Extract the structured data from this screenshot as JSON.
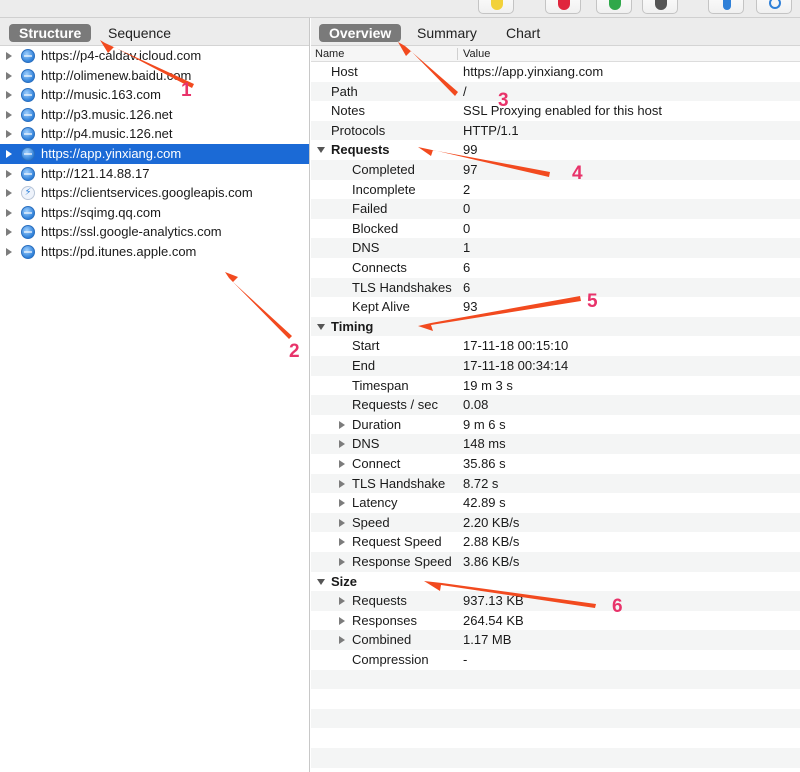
{
  "colors": {
    "selection": "#1b6ad6",
    "active_tab": "#7a7a7a",
    "arrow": "#f24a1f",
    "callout": "#e8336a"
  },
  "left_tabs": [
    "Structure",
    "Sequence"
  ],
  "right_tabs": [
    "Overview",
    "Summary",
    "Chart"
  ],
  "hosts": [
    {
      "url": "https://p4-caldav.icloud.com",
      "icon": "globe-icon"
    },
    {
      "url": "http://olimenew.baidu.com",
      "icon": "globe-icon"
    },
    {
      "url": "http://music.163.com",
      "icon": "globe-icon"
    },
    {
      "url": "http://p3.music.126.net",
      "icon": "globe-icon"
    },
    {
      "url": "http://p4.music.126.net",
      "icon": "globe-icon"
    },
    {
      "url": "https://app.yinxiang.com",
      "icon": "globe-icon",
      "selected": true
    },
    {
      "url": "http://121.14.88.17",
      "icon": "globe-icon"
    },
    {
      "url": "https://clientservices.googleapis.com",
      "icon": "lightning-icon"
    },
    {
      "url": "https://sqimg.qq.com",
      "icon": "globe-icon"
    },
    {
      "url": "https://ssl.google-analytics.com",
      "icon": "globe-icon"
    },
    {
      "url": "https://pd.itunes.apple.com",
      "icon": "globe-icon"
    }
  ],
  "columns": {
    "name": "Name",
    "value": "Value"
  },
  "rows": [
    {
      "name": "Host",
      "value": "https://app.yinxiang.com",
      "indent": 0
    },
    {
      "name": "Path",
      "value": "/",
      "indent": 0
    },
    {
      "name": "Notes",
      "value": "SSL Proxying enabled for this host",
      "indent": 0
    },
    {
      "name": "Protocols",
      "value": "HTTP/1.1",
      "indent": 0
    },
    {
      "name": "Requests",
      "value": "99",
      "indent": 0,
      "section": true
    },
    {
      "name": "Completed",
      "value": "97",
      "indent": 1
    },
    {
      "name": "Incomplete",
      "value": "2",
      "indent": 1
    },
    {
      "name": "Failed",
      "value": "0",
      "indent": 1
    },
    {
      "name": "Blocked",
      "value": "0",
      "indent": 1
    },
    {
      "name": "DNS",
      "value": "1",
      "indent": 1
    },
    {
      "name": "Connects",
      "value": "6",
      "indent": 1
    },
    {
      "name": "TLS Handshakes",
      "value": "6",
      "indent": 1
    },
    {
      "name": "Kept Alive",
      "value": "93",
      "indent": 1
    },
    {
      "name": "Timing",
      "value": "",
      "indent": 0,
      "section": true
    },
    {
      "name": "Start",
      "value": "17-11-18 00:15:10",
      "indent": 1
    },
    {
      "name": "End",
      "value": "17-11-18 00:34:14",
      "indent": 1
    },
    {
      "name": "Timespan",
      "value": "19 m 3 s",
      "indent": 1
    },
    {
      "name": "Requests / sec",
      "value": "0.08",
      "indent": 1
    },
    {
      "name": "Duration",
      "value": "9 m 6 s",
      "indent": 1,
      "expandable": true
    },
    {
      "name": "DNS",
      "value": "148 ms",
      "indent": 1,
      "expandable": true
    },
    {
      "name": "Connect",
      "value": "35.86 s",
      "indent": 1,
      "expandable": true
    },
    {
      "name": "TLS Handshake",
      "value": "8.72 s",
      "indent": 1,
      "expandable": true
    },
    {
      "name": "Latency",
      "value": "42.89 s",
      "indent": 1,
      "expandable": true
    },
    {
      "name": "Speed",
      "value": "2.20 KB/s",
      "indent": 1,
      "expandable": true
    },
    {
      "name": "Request Speed",
      "value": "2.88 KB/s",
      "indent": 1,
      "expandable": true
    },
    {
      "name": "Response Speed",
      "value": "3.86 KB/s",
      "indent": 1,
      "expandable": true
    },
    {
      "name": "Size",
      "value": "",
      "indent": 0,
      "section": true
    },
    {
      "name": "Requests",
      "value": "937.13 KB",
      "indent": 1,
      "expandable": true
    },
    {
      "name": "Responses",
      "value": "264.54 KB",
      "indent": 1,
      "expandable": true
    },
    {
      "name": "Combined",
      "value": "1.17 MB",
      "indent": 1,
      "expandable": true
    },
    {
      "name": "Compression",
      "value": "-",
      "indent": 1
    }
  ],
  "annotations": [
    "1",
    "2",
    "3",
    "4",
    "5",
    "6"
  ]
}
